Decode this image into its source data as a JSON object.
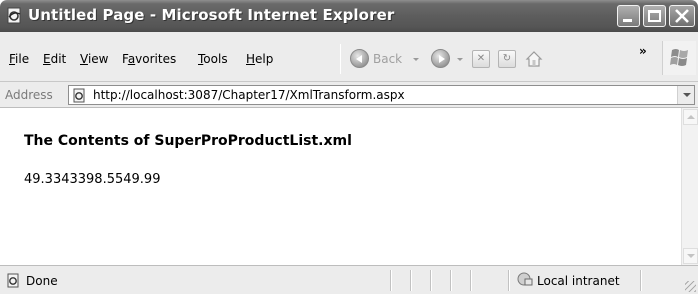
{
  "window": {
    "title": "Untitled Page - Microsoft Internet Explorer"
  },
  "menubar": {
    "items": [
      {
        "label": "File",
        "accel": "F",
        "rest": "ile"
      },
      {
        "label": "Edit",
        "accel": "E",
        "rest": "dit"
      },
      {
        "label": "View",
        "accel": "V",
        "rest": "iew"
      },
      {
        "label": "Favorites",
        "accel": "a",
        "pre": "F",
        "rest": "vorites"
      },
      {
        "label": "Tools",
        "accel": "T",
        "rest": "ools"
      },
      {
        "label": "Help",
        "accel": "H",
        "rest": "elp"
      }
    ],
    "back_label": "Back",
    "chevron": "»"
  },
  "address": {
    "label": "Address",
    "url": "http://localhost:3087/Chapter17/XmlTransform.aspx"
  },
  "page": {
    "heading": "The Contents of SuperProProductList.xml",
    "output": "49.3343398.5549.99"
  },
  "status": {
    "text": "Done",
    "zone": "Local intranet"
  },
  "icons": {
    "title": "ie-page-icon",
    "back": "back-arrow-icon",
    "forward": "forward-arrow-icon",
    "stop": "stop-icon",
    "refresh": "refresh-icon",
    "home": "home-icon",
    "windows_logo": "windows-logo-icon",
    "address_page": "ie-page-icon",
    "status_page": "ie-page-icon",
    "zone": "local-intranet-icon"
  }
}
